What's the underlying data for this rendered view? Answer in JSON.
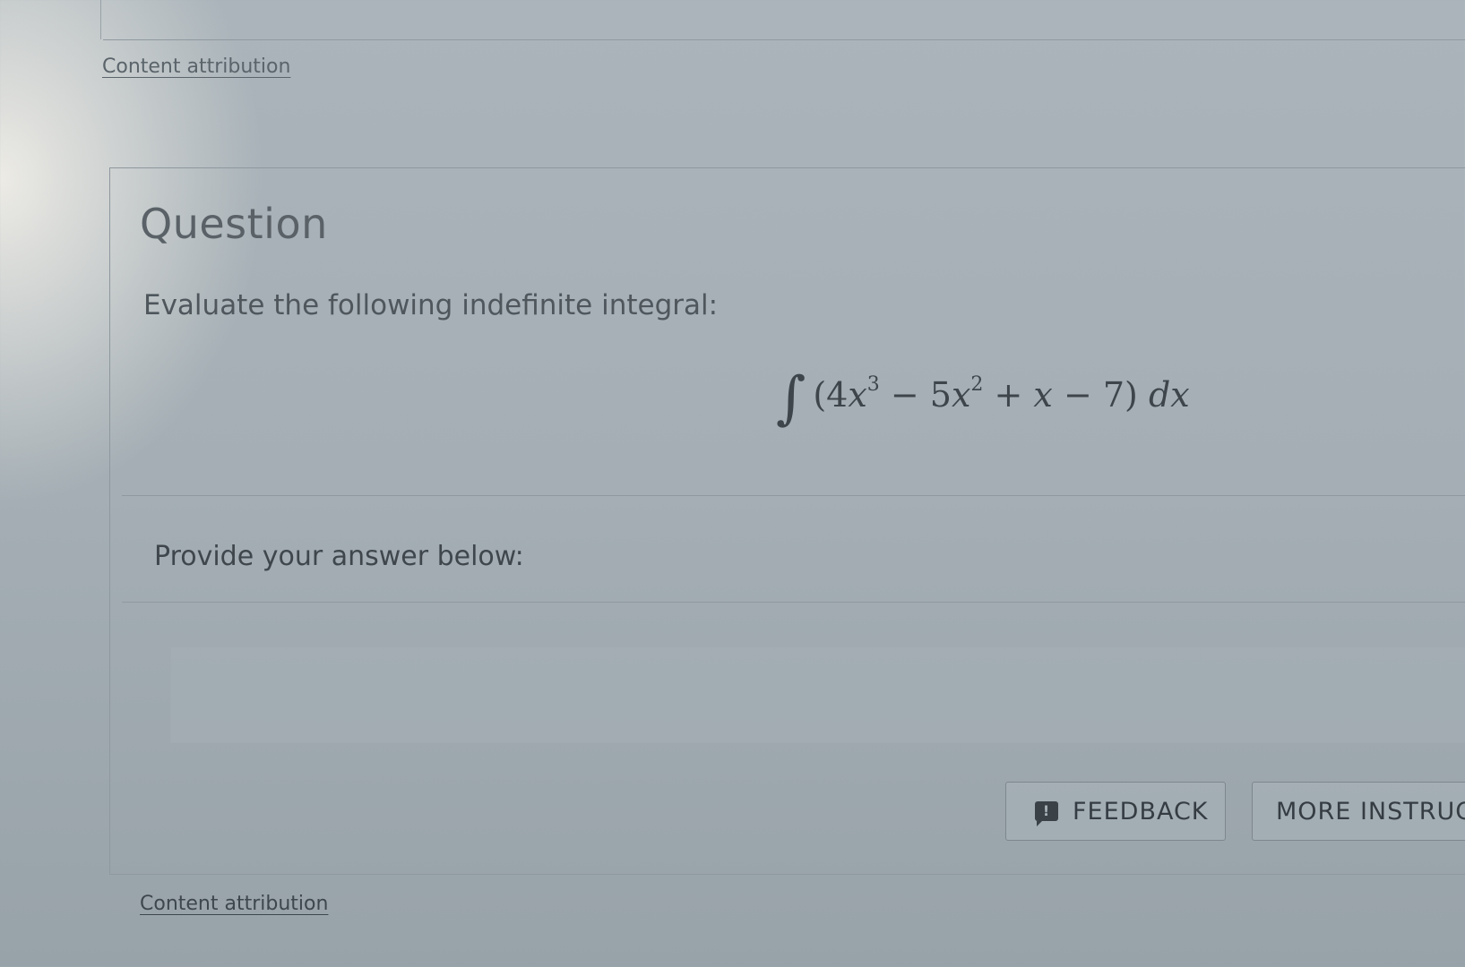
{
  "top_attribution": "Content attribution",
  "question": {
    "title": "Question",
    "prompt": "Evaluate the following indefinite integral:",
    "formula": {
      "integral_sign": "∫",
      "open": "(4",
      "var1": "x",
      "exp1": "3",
      "minus1": " − 5",
      "var2": "x",
      "exp2": "2",
      "plus": " + ",
      "var3": "x",
      "tail": " − 7) ",
      "dx": "dx"
    }
  },
  "answer": {
    "label": "Provide your answer below:",
    "value": "",
    "placeholder": ""
  },
  "buttons": {
    "feedback": "FEEDBACK",
    "feedback_icon": "feedback-icon",
    "more_instructions": "MORE INSTRUC"
  },
  "bottom_attribution": "Content attribution"
}
